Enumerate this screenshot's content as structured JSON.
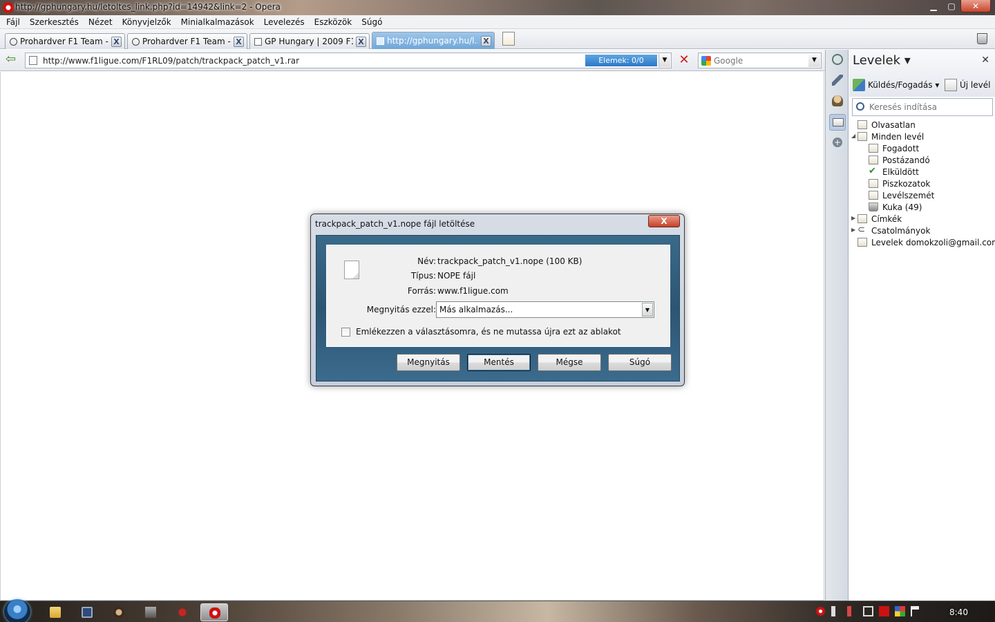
{
  "window": {
    "title": "http://gphungary.hu/letoltes_link.php?id=14942&link=2 - Opera",
    "minimize": "▁",
    "maximize": "▢",
    "close": "✕"
  },
  "menu": [
    "Fájl",
    "Szerkesztés",
    "Nézet",
    "Könyvjelzők",
    "Minialkalmazások",
    "Levelezés",
    "Eszközök",
    "Súgó"
  ],
  "tabs": [
    {
      "label": "Prohardver F1 Team - ...",
      "close": "X"
    },
    {
      "label": "Prohardver F1 Team - ...",
      "close": "X"
    },
    {
      "label": "GP Hungary | 2009 F1 T...",
      "close": "X"
    },
    {
      "label": "http://gphungary.hu/l...",
      "close": "X",
      "active": true
    }
  ],
  "addressbar": {
    "back": "⇦",
    "url": "http://www.f1ligue.com/F1RL09/patch/trackpack_patch_v1.rar",
    "progress": "Elemek:  0/0",
    "dropdown": "▼",
    "stop": "✕"
  },
  "search": {
    "placeholder": "Google",
    "dropdown": "▼"
  },
  "panel": {
    "title": "Levelek ▾",
    "close": "✕",
    "add": "+",
    "send_receive": "Küldés/Fogadás ▾",
    "new_mail": "Új levél",
    "search_placeholder": "Keresés indítása",
    "tree": [
      {
        "label": "Olvasatlan",
        "level": 1
      },
      {
        "label": "Minden levél",
        "level": 1,
        "arrow": "◢"
      },
      {
        "label": "Fogadott",
        "level": 2
      },
      {
        "label": "Postázandó",
        "level": 2
      },
      {
        "label": "Elküldött",
        "level": 2,
        "icon": "✔"
      },
      {
        "label": "Piszkozatok",
        "level": 2
      },
      {
        "label": "Levélszemét",
        "level": 2
      },
      {
        "label": "Kuka (49)",
        "level": 2
      },
      {
        "label": "Címkék",
        "level": 1,
        "arrow": "▶"
      },
      {
        "label": "Csatolmányok",
        "level": 1,
        "arrow": "▶",
        "icon": "⊂"
      },
      {
        "label": "Levelek domokzoli@gmail.com",
        "level": 1
      }
    ]
  },
  "dialog": {
    "title": "trackpack_patch_v1.nope fájl letöltése",
    "close": "X",
    "name_label": "Név:",
    "name_value": "trackpack_patch_v1.nope (100 KB)",
    "type_label": "Típus:",
    "type_value": "NOPE fájl",
    "source_label": "Forrás:",
    "source_value": "www.f1ligue.com",
    "open_with_label": "Megnyitás ezzel:",
    "open_with_value": "Más alkalmazás...",
    "open_with_dropdown": "▼",
    "remember_label": "Emlékezzen a választásomra, és ne mutassa újra ezt az ablakot",
    "remember_checked": false,
    "buttons": {
      "open": "Megnyitás",
      "save": "Mentés",
      "cancel": "Mégse",
      "help": "Súgó"
    }
  },
  "taskbar": {
    "clock": "8:40"
  },
  "colors": {
    "active_tab": "#6fa7d8",
    "progress": "#2b78c9",
    "dialog_frame": "#2c5572"
  }
}
